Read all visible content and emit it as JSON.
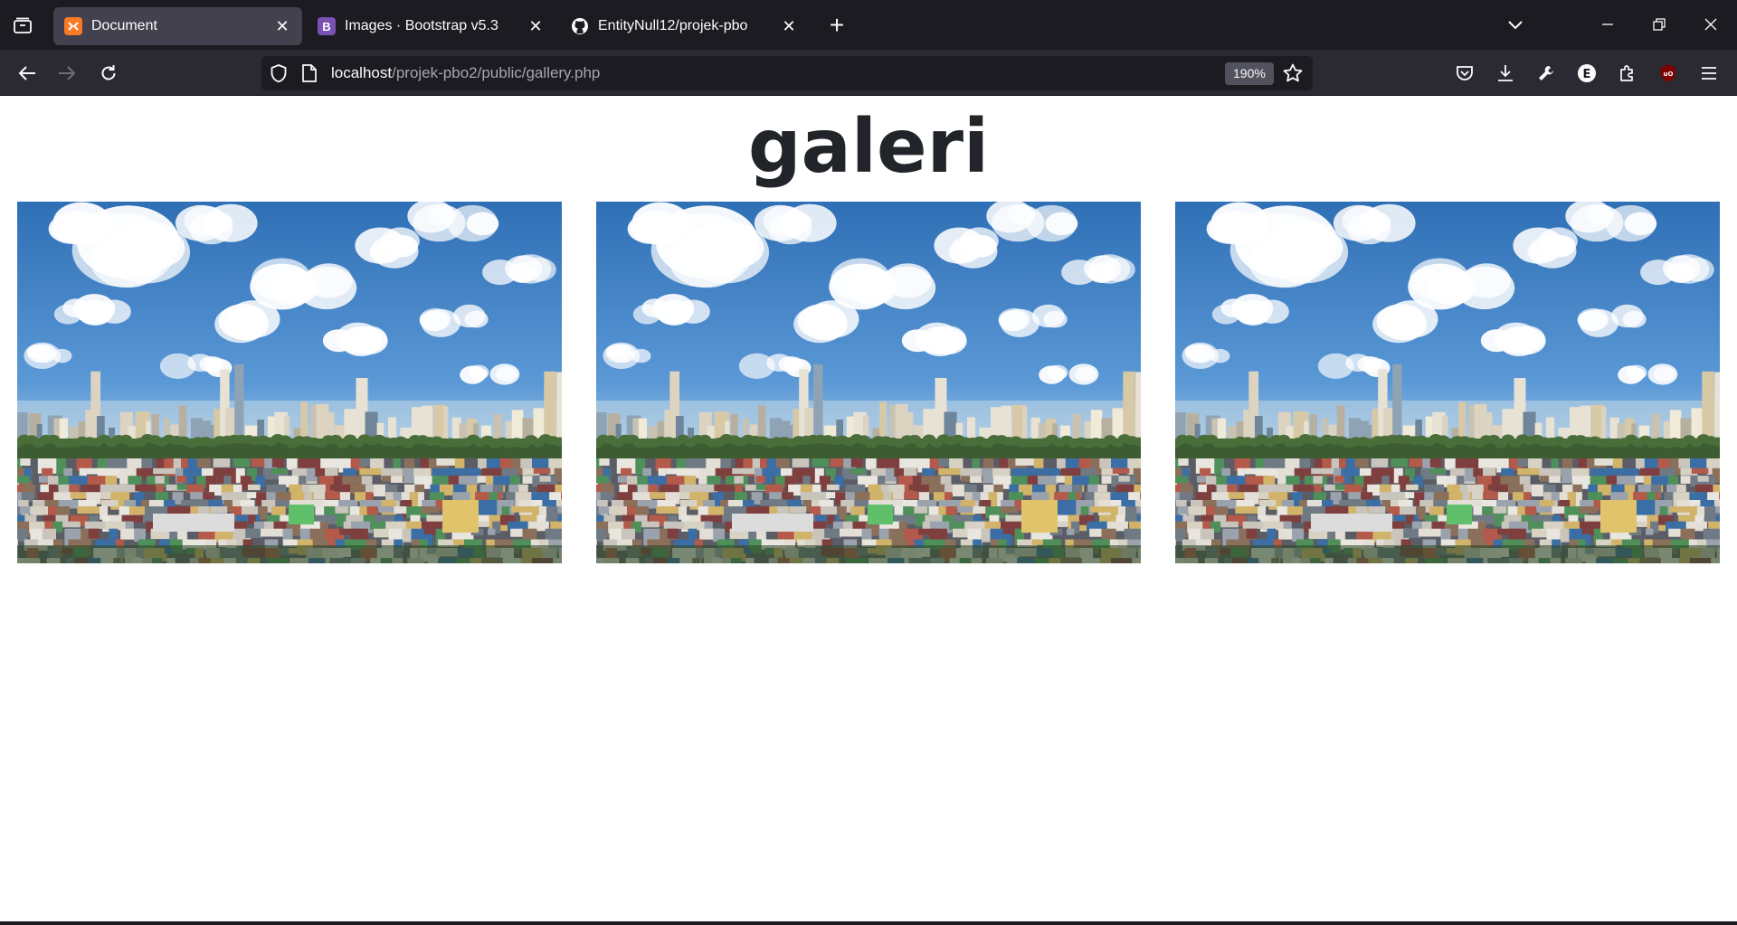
{
  "browser": {
    "tabs": [
      {
        "title": "Document",
        "favicon": "xampp-icon",
        "favicon_color": "#fb7a24",
        "active": true
      },
      {
        "title": "Images · Bootstrap v5.3",
        "favicon": "bootstrap-icon",
        "favicon_color": "#7952b3",
        "favicon_letter": "B",
        "active": false
      },
      {
        "title": "EntityNull12/projek-pbo",
        "favicon": "github-icon",
        "favicon_color": "#ffffff",
        "active": false
      }
    ],
    "url": {
      "host": "localhost",
      "path": "/projek-pbo2/public/gallery.php"
    },
    "zoom": "190%",
    "colors": {
      "tabstrip": "#1c1b22",
      "toolbar": "#2b2a33",
      "urlbar": "#1c1b22",
      "active_tab": "#42414d"
    }
  },
  "page": {
    "heading": "galeri",
    "images": [
      {
        "alt": "city skyline"
      },
      {
        "alt": "city skyline"
      },
      {
        "alt": "city skyline"
      }
    ]
  }
}
